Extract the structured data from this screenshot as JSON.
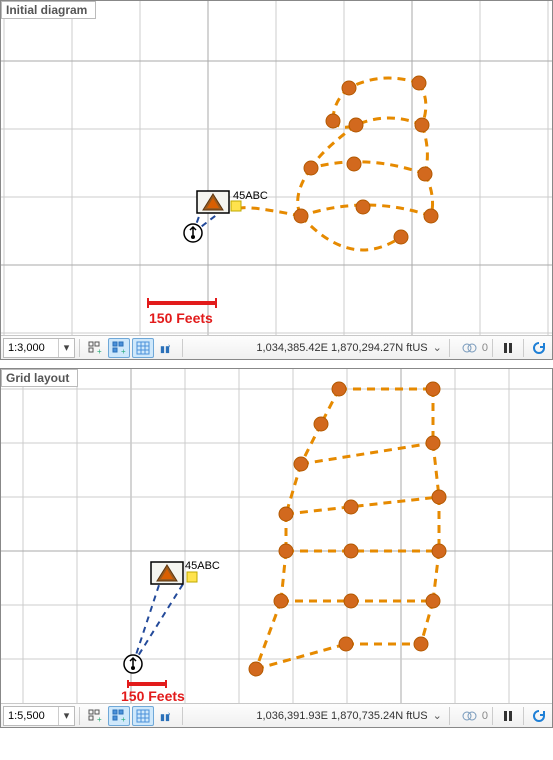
{
  "panels": [
    {
      "title": "Initial diagram",
      "label_45abc": "45ABC",
      "scale_bar": "150 Feets",
      "scale_select": "1:3,000",
      "coords": "1,034,385.42E 1,870,294.27N ftUS",
      "snap_count": "0"
    },
    {
      "title": "Grid layout",
      "label_45abc": "45ABC",
      "scale_bar": "150 Feets",
      "scale_select": "1:5,500",
      "coords": "1,036,391.93E 1,870,735.24N ftUS",
      "snap_count": "0"
    }
  ]
}
